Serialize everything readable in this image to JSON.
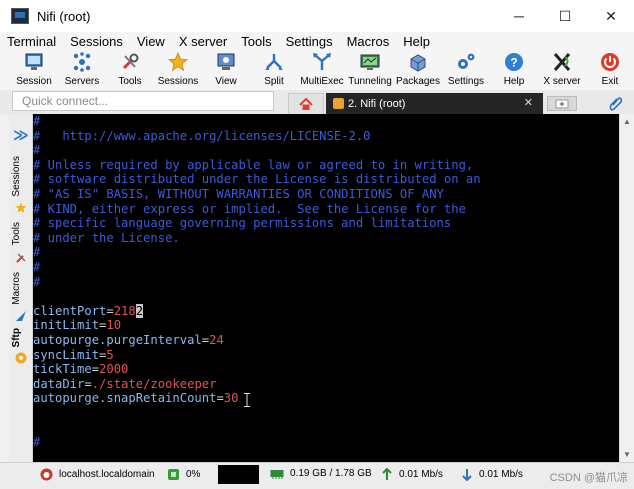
{
  "window": {
    "title": "Nifi (root)",
    "minimize": "─",
    "maximize": "☐",
    "close": "✕"
  },
  "menu": [
    "Terminal",
    "Sessions",
    "View",
    "X server",
    "Tools",
    "Settings",
    "Macros",
    "Help"
  ],
  "toolbar": [
    {
      "label": "Session",
      "icon": "session-icon"
    },
    {
      "label": "Servers",
      "icon": "servers-icon"
    },
    {
      "label": "Tools",
      "icon": "tools-icon"
    },
    {
      "label": "Sessions",
      "icon": "sessions-star-icon"
    },
    {
      "label": "View",
      "icon": "view-icon"
    },
    {
      "label": "Split",
      "icon": "split-icon"
    },
    {
      "label": "MultiExec",
      "icon": "multiexec-icon"
    },
    {
      "label": "Tunneling",
      "icon": "tunneling-icon"
    },
    {
      "label": "Packages",
      "icon": "packages-icon"
    },
    {
      "label": "Settings",
      "icon": "settings-icon"
    },
    {
      "label": "Help",
      "icon": "help-icon"
    },
    {
      "label": "X server",
      "icon": "xserver-icon"
    },
    {
      "label": "Exit",
      "icon": "exit-icon"
    }
  ],
  "quick_connect": {
    "placeholder": "Quick connect..."
  },
  "tab": {
    "label": "2. Nifi (root)",
    "close": "✕"
  },
  "sidebar": {
    "chevron": "≫",
    "labels": [
      "Sessions",
      "Tools",
      "Macros",
      "Sftp"
    ]
  },
  "terminal": {
    "lines": [
      [
        {
          "t": "#",
          "c": "comment"
        }
      ],
      [
        {
          "t": "#   http://www.apache.org/licenses/LICENSE-2.0",
          "c": "comment"
        }
      ],
      [
        {
          "t": "#",
          "c": "comment"
        }
      ],
      [
        {
          "t": "# Unless required by applicable law or agreed to in writing,",
          "c": "comment"
        }
      ],
      [
        {
          "t": "# software distributed under the License is distributed on an",
          "c": "comment"
        }
      ],
      [
        {
          "t": "# \"AS IS\" BASIS, WITHOUT WARRANTIES OR CONDITIONS OF ANY",
          "c": "comment"
        }
      ],
      [
        {
          "t": "# KIND, either express or implied.  See the License for the",
          "c": "comment"
        }
      ],
      [
        {
          "t": "# specific language governing permissions and limitations",
          "c": "comment"
        }
      ],
      [
        {
          "t": "# under the License.",
          "c": "comment"
        }
      ],
      [
        {
          "t": "#",
          "c": "comment"
        }
      ],
      [
        {
          "t": "#",
          "c": "comment"
        }
      ],
      [
        {
          "t": "#",
          "c": "comment"
        }
      ],
      [
        {
          "t": "",
          "c": "eq"
        }
      ],
      [
        {
          "t": "clientPort",
          "c": "key"
        },
        {
          "t": "=",
          "c": "eq"
        },
        {
          "t": "218",
          "c": "val"
        },
        {
          "t": "2",
          "c": "cursor"
        }
      ],
      [
        {
          "t": "initLimit",
          "c": "key"
        },
        {
          "t": "=",
          "c": "eq"
        },
        {
          "t": "10",
          "c": "val"
        }
      ],
      [
        {
          "t": "autopurge.purgeInterval",
          "c": "key"
        },
        {
          "t": "=",
          "c": "eq"
        },
        {
          "t": "24",
          "c": "val"
        }
      ],
      [
        {
          "t": "syncLimit",
          "c": "key"
        },
        {
          "t": "=",
          "c": "eq"
        },
        {
          "t": "5",
          "c": "val"
        }
      ],
      [
        {
          "t": "tickTime",
          "c": "key"
        },
        {
          "t": "=",
          "c": "eq"
        },
        {
          "t": "2000",
          "c": "val"
        }
      ],
      [
        {
          "t": "dataDir",
          "c": "key"
        },
        {
          "t": "=",
          "c": "eq"
        },
        {
          "t": "./state/zookeeper",
          "c": "val"
        }
      ],
      [
        {
          "t": "autopurge.snapRetainCount",
          "c": "key"
        },
        {
          "t": "=",
          "c": "eq"
        },
        {
          "t": "30",
          "c": "val"
        }
      ],
      [
        {
          "t": "",
          "c": "eq"
        }
      ],
      [
        {
          "t": "",
          "c": "eq"
        }
      ],
      [
        {
          "t": "#",
          "c": "comment"
        }
      ]
    ]
  },
  "status": {
    "host": "localhost.localdomain",
    "cpu": "0%",
    "memory": "0.19 GB / 1.78 GB",
    "upload": "0.01 Mb/s",
    "download": "0.01 Mb/s",
    "watermark": "CSDN @猫爪凉"
  },
  "colors": {
    "comment": "#3a5bd8",
    "key": "#8ab8ee",
    "value": "#e05252",
    "terminal_bg": "#000000",
    "tab_active": "#252525"
  }
}
